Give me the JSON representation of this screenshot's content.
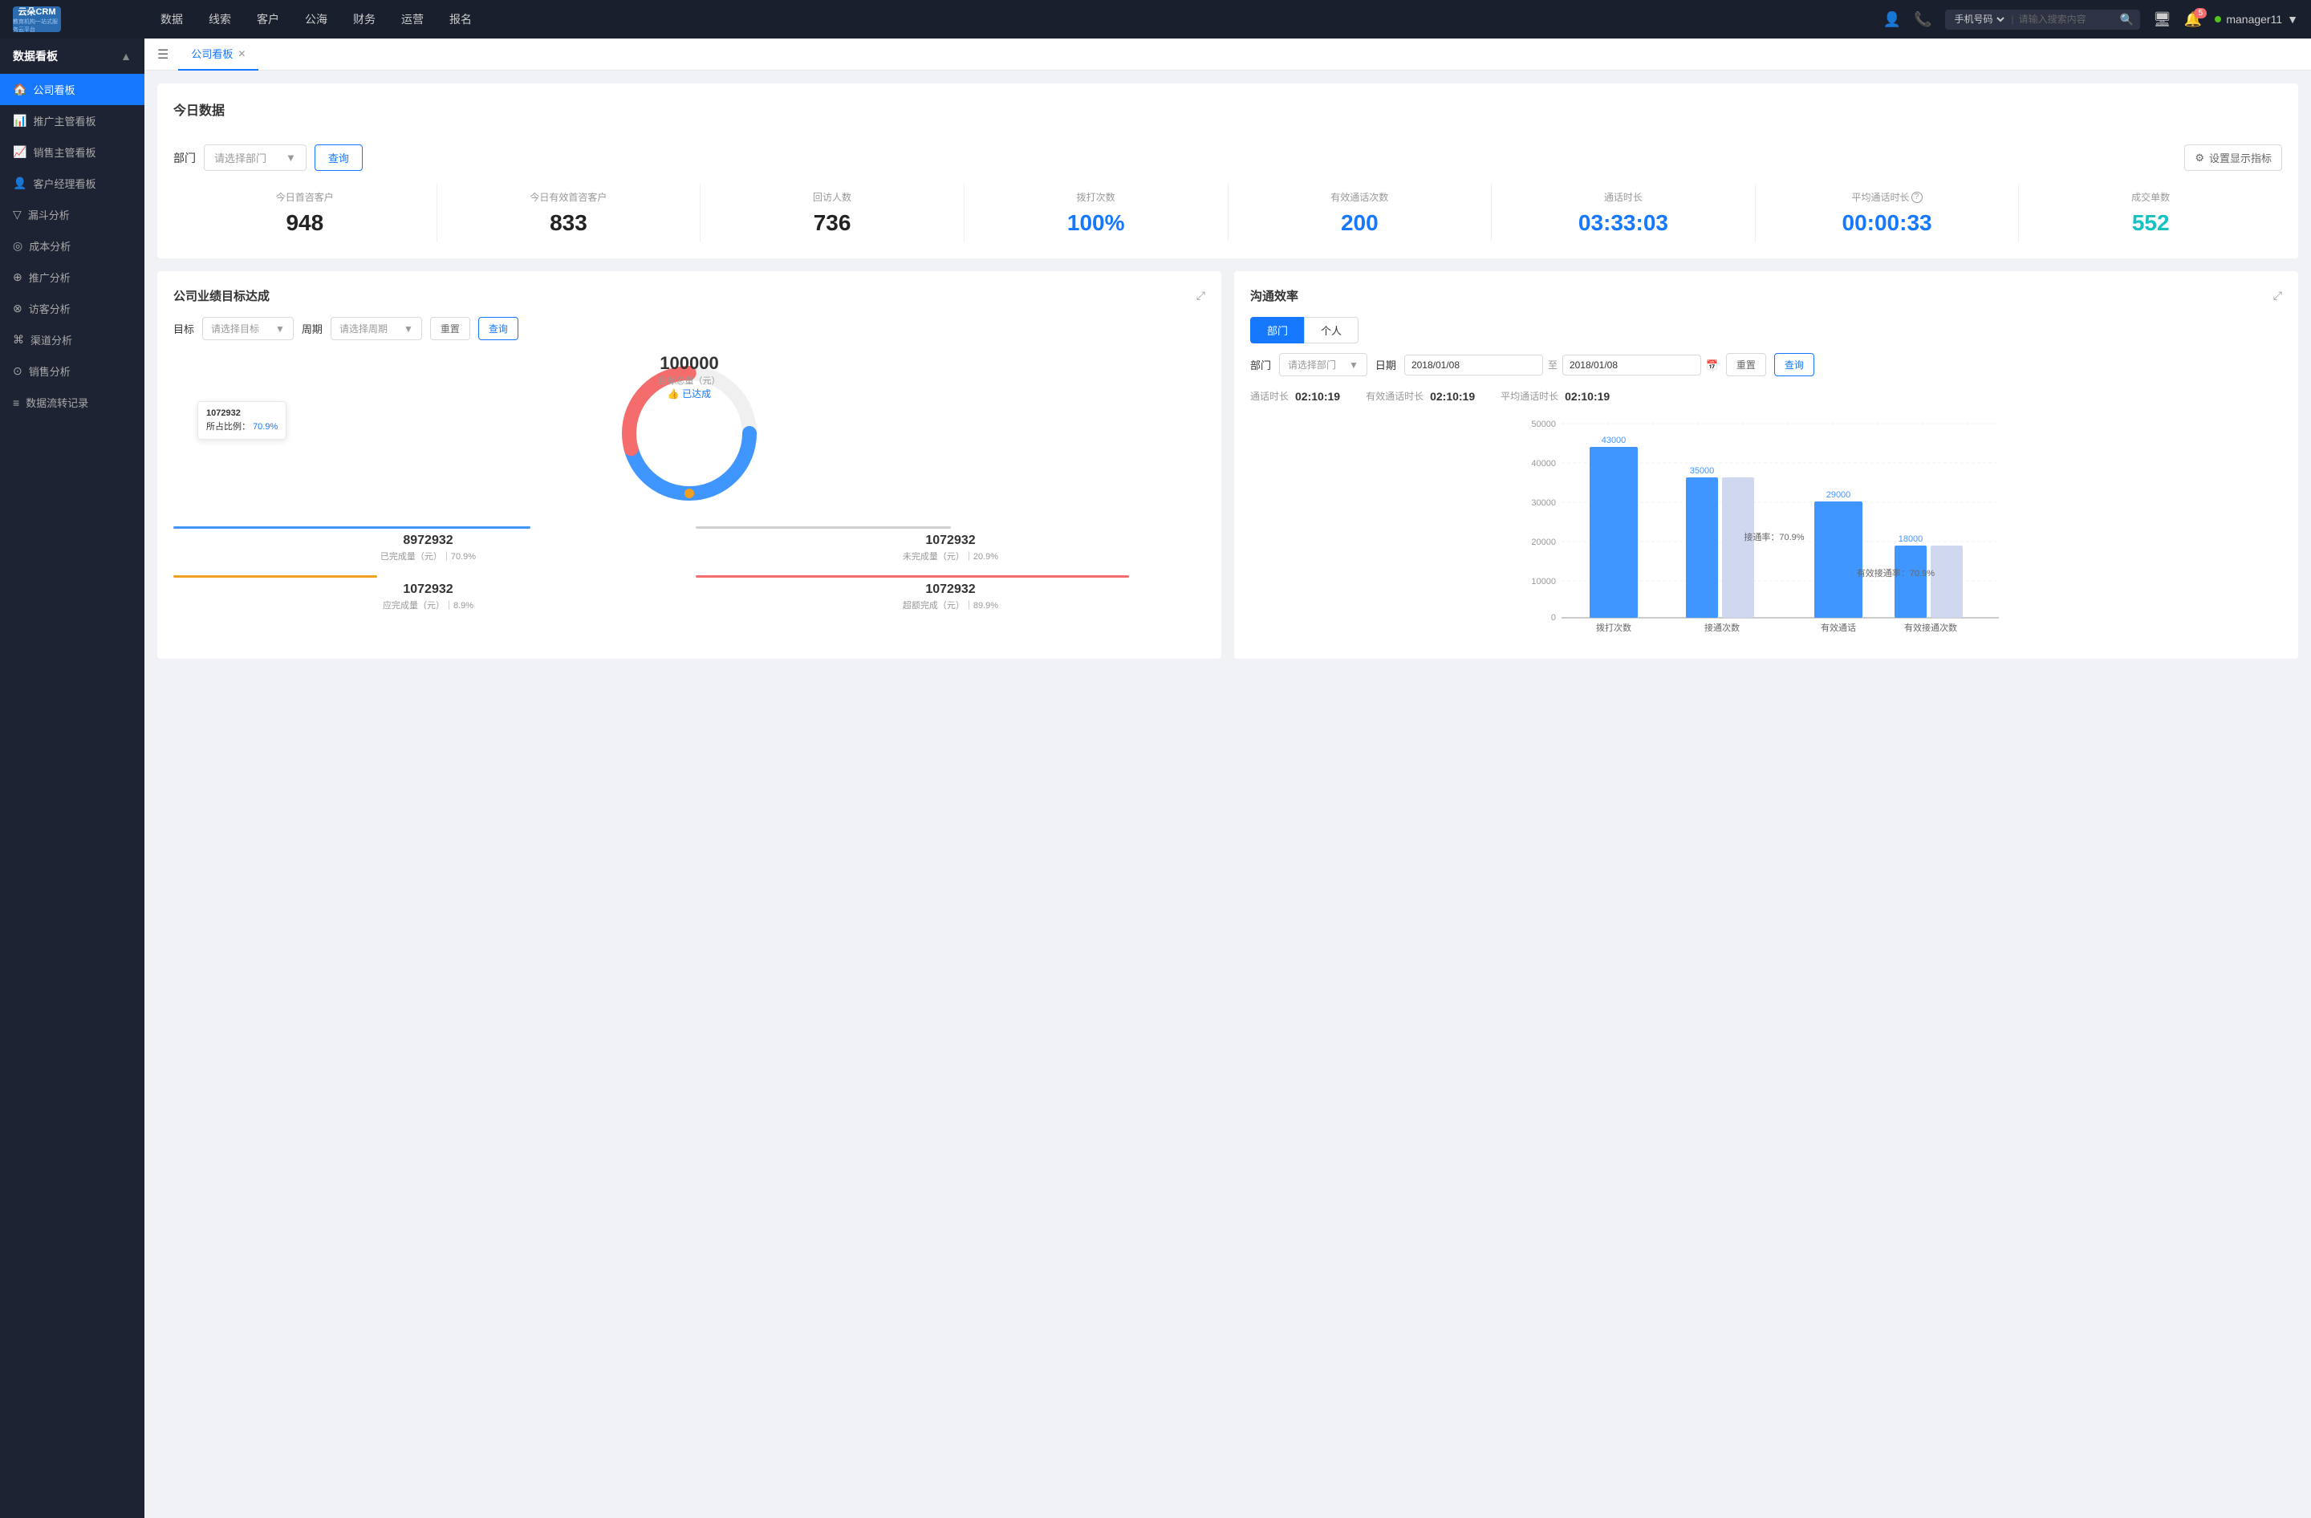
{
  "app": {
    "logo_main": "云朵CRM",
    "logo_sub": "教育机构一站式服务云平台"
  },
  "top_nav": {
    "items": [
      "数据",
      "线索",
      "客户",
      "公海",
      "财务",
      "运营",
      "报名"
    ],
    "search_placeholder": "请输入搜索内容",
    "search_select": "手机号码",
    "notification_count": "5",
    "username": "manager11"
  },
  "sidebar": {
    "section_title": "数据看板",
    "items": [
      {
        "label": "公司看板",
        "icon": "🏠",
        "active": true
      },
      {
        "label": "推广主管看板",
        "icon": "📊",
        "active": false
      },
      {
        "label": "销售主管看板",
        "icon": "📈",
        "active": false
      },
      {
        "label": "客户经理看板",
        "icon": "👤",
        "active": false
      },
      {
        "label": "漏斗分析",
        "icon": "▽",
        "active": false
      },
      {
        "label": "成本分析",
        "icon": "◎",
        "active": false
      },
      {
        "label": "推广分析",
        "icon": "⊕",
        "active": false
      },
      {
        "label": "访客分析",
        "icon": "⊗",
        "active": false
      },
      {
        "label": "渠道分析",
        "icon": "⌘",
        "active": false
      },
      {
        "label": "销售分析",
        "icon": "⊙",
        "active": false
      },
      {
        "label": "数据流转记录",
        "icon": "≡",
        "active": false
      }
    ]
  },
  "tabs": [
    {
      "label": "公司看板",
      "active": true,
      "closable": true
    }
  ],
  "today_data": {
    "title": "今日数据",
    "dept_label": "部门",
    "dept_placeholder": "请选择部门",
    "query_btn": "查询",
    "settings_btn": "设置显示指标",
    "metrics": [
      {
        "label": "今日首咨客户",
        "value": "948",
        "color": "black"
      },
      {
        "label": "今日有效首咨客户",
        "value": "833",
        "color": "black"
      },
      {
        "label": "回访人数",
        "value": "736",
        "color": "black"
      },
      {
        "label": "拨打次数",
        "value": "100%",
        "color": "blue"
      },
      {
        "label": "有效通话次数",
        "value": "200",
        "color": "blue"
      },
      {
        "label": "通话时长",
        "value": "03:33:03",
        "color": "blue"
      },
      {
        "label": "平均通话时长",
        "value": "00:00:33",
        "color": "blue"
      },
      {
        "label": "成交单数",
        "value": "552",
        "color": "cyan"
      }
    ]
  },
  "performance": {
    "title": "公司业绩目标达成",
    "target_label": "目标",
    "target_placeholder": "请选择目标",
    "period_label": "周期",
    "period_placeholder": "请选择周期",
    "reset_btn": "重置",
    "query_btn": "查询",
    "donut": {
      "center_value": "100000",
      "center_label": "目标总量（元）",
      "achieved_label": "👍 已达成",
      "tooltip_value": "1072932",
      "tooltip_pct_label": "所占比例：",
      "tooltip_pct": "70.9%"
    },
    "stats": [
      {
        "label": "已完成量（元）｜70.9%",
        "value": "8972932",
        "bar_color": "#1677ff",
        "bar_width": "70%"
      },
      {
        "label": "未完成量（元）｜20.9%",
        "value": "1072932",
        "bar_color": "#d0d0d0",
        "bar_width": "30%"
      },
      {
        "label": "应完成量（元）｜8.9%",
        "value": "1072932",
        "bar_color": "#f0a020",
        "bar_width": "20%"
      },
      {
        "label": "超额完成（元）｜89.9%",
        "value": "1072932",
        "bar_color": "#f56c6c",
        "bar_width": "85%"
      }
    ]
  },
  "comm_efficiency": {
    "title": "沟通效率",
    "tabs": [
      "部门",
      "个人"
    ],
    "active_tab": "部门",
    "dept_label": "部门",
    "dept_placeholder": "请选择部门",
    "date_label": "日期",
    "date_start": "2018/01/08",
    "date_end": "2018/01/08",
    "date_sep": "至",
    "reset_btn": "重置",
    "query_btn": "查询",
    "stats": [
      {
        "label": "通话时长",
        "value": "02:10:19"
      },
      {
        "label": "有效通话时长",
        "value": "02:10:19"
      },
      {
        "label": "平均通话时长",
        "value": "02:10:19"
      }
    ],
    "chart": {
      "y_labels": [
        "50000",
        "40000",
        "30000",
        "20000",
        "10000",
        "0"
      ],
      "groups": [
        {
          "label": "拨打次数",
          "bars": [
            {
              "value": 43000,
              "height_pct": 86,
              "label": "43000",
              "color": "#4096ff"
            }
          ]
        },
        {
          "label": "接通次数",
          "bars": [
            {
              "value": 35000,
              "height_pct": 70,
              "label": "35000",
              "color": "#4096ff"
            },
            {
              "value": null,
              "height_pct": 70,
              "label": "",
              "color": "#c0d0f0"
            }
          ],
          "rate_label": "接通率：70.9%"
        },
        {
          "label": "有效通话",
          "bars": [
            {
              "value": 29000,
              "height_pct": 58,
              "label": "29000",
              "color": "#4096ff"
            }
          ]
        },
        {
          "label": "有效接通次数",
          "bars": [
            {
              "value": 18000,
              "height_pct": 36,
              "label": "18000",
              "color": "#4096ff"
            },
            {
              "value": null,
              "height_pct": 36,
              "label": "",
              "color": "#c0d0f0"
            }
          ],
          "rate_label": "有效接通率：70.9%"
        }
      ]
    }
  }
}
